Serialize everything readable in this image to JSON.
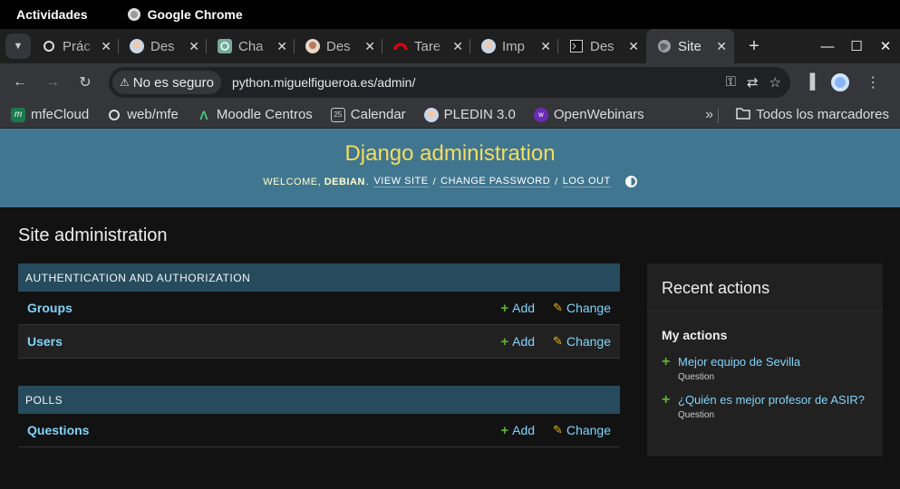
{
  "system": {
    "activities": "Actividades",
    "app_name": "Google Chrome"
  },
  "tabs": [
    {
      "title": "Prác",
      "icon": "circle-icon",
      "active": false
    },
    {
      "title": "Des",
      "icon": "avatar-icon",
      "active": false
    },
    {
      "title": "Cha",
      "icon": "chatgpt-icon",
      "active": false
    },
    {
      "title": "Des",
      "icon": "avatar-icon",
      "active": false
    },
    {
      "title": "Tare",
      "icon": "redhat-icon",
      "active": false
    },
    {
      "title": "Imp",
      "icon": "avatar-icon",
      "active": false
    },
    {
      "title": "Des",
      "icon": "terminal-icon",
      "active": false
    },
    {
      "title": "Site",
      "icon": "globe-icon",
      "active": true
    }
  ],
  "toolbar": {
    "security_label": "No es seguro",
    "url": "python.miguelfigueroa.es/admin/"
  },
  "bookmarks": [
    {
      "label": "mfeCloud",
      "icon": "mfe-icon"
    },
    {
      "label": "web/mfe",
      "icon": "circle-icon"
    },
    {
      "label": "Moodle Centros",
      "icon": "moodle-icon"
    },
    {
      "label": "Calendar",
      "icon": "calendar-icon"
    },
    {
      "label": "PLEDIN 3.0",
      "icon": "avatar-icon"
    },
    {
      "label": "OpenWebinars",
      "icon": "ow-icon"
    }
  ],
  "bookmarks_more": "»",
  "bookmarks_all": "Todos los marcadores",
  "django": {
    "branding": "Django administration",
    "welcome": "WELCOME,",
    "username": "DEBIAN",
    "view_site": "VIEW SITE",
    "change_password": "CHANGE PASSWORD",
    "log_out": "LOG OUT",
    "page_title": "Site administration",
    "modules": [
      {
        "caption": "AUTHENTICATION AND AUTHORIZATION",
        "rows": [
          {
            "name": "Groups",
            "add": "Add",
            "change": "Change"
          },
          {
            "name": "Users",
            "add": "Add",
            "change": "Change"
          }
        ]
      },
      {
        "caption": "POLLS",
        "rows": [
          {
            "name": "Questions",
            "add": "Add",
            "change": "Change"
          }
        ]
      }
    ],
    "recent": {
      "title": "Recent actions",
      "subtitle": "My actions",
      "items": [
        {
          "label": "Mejor equipo de Sevilla",
          "type": "Question"
        },
        {
          "label": "¿Quién es mejor profesor de ASIR?",
          "type": "Question"
        }
      ]
    }
  },
  "colors": {
    "header_bg": "#417690",
    "branding": "#f5dd5d",
    "caption_bg": "#264b5d",
    "link": "#81d4fa",
    "add_green": "#5fb230",
    "change_yellow": "#efb80b"
  }
}
